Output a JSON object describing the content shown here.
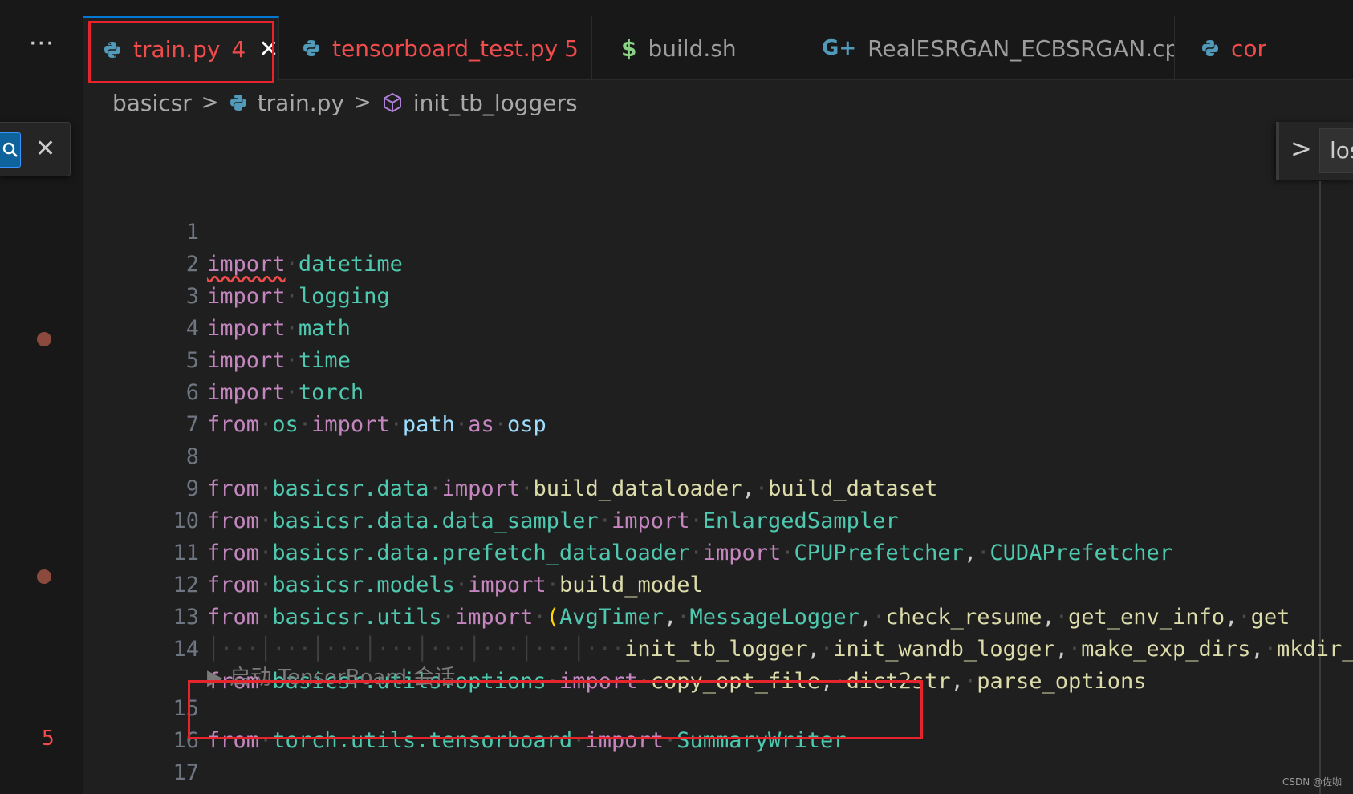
{
  "tabs": [
    {
      "label": "train.py",
      "count": "4",
      "close": "✕",
      "icon": "python-icon",
      "active": true
    },
    {
      "label": "tensorboard_test.py",
      "count": "5",
      "icon": "python-icon"
    },
    {
      "label": "build.sh",
      "icon": "shell-dollar-icon",
      "icon_text": "$"
    },
    {
      "label": "RealESRGAN_ECBSRGAN.cpp",
      "icon": "cpp-icon",
      "icon_text": "G+"
    },
    {
      "label": "cor",
      "icon": "python-icon"
    }
  ],
  "toolbar": {
    "more": "···"
  },
  "breadcrumb": {
    "items": [
      "basicsr",
      "train.py",
      "init_tb_loggers"
    ],
    "sep": ">"
  },
  "find_widget": {
    "close": "✕"
  },
  "sticky_widget": {
    "chevron": ">",
    "text": "los"
  },
  "lines": [
    {
      "num": "1"
    },
    {
      "num": "2"
    },
    {
      "num": "3"
    },
    {
      "num": "4"
    },
    {
      "num": "5"
    },
    {
      "num": "6"
    },
    {
      "num": "7"
    },
    {
      "num": "8"
    },
    {
      "num": "9"
    },
    {
      "num": "10"
    },
    {
      "num": "11"
    },
    {
      "num": "12"
    },
    {
      "num": "13"
    },
    {
      "num": "14"
    },
    {
      "num": "15"
    },
    {
      "num": "16"
    },
    {
      "num": "17"
    }
  ],
  "code": {
    "import": "import",
    "from": "from",
    "as": "as",
    "datetime": "datetime",
    "logging": "logging",
    "math": "math",
    "time": "time",
    "torch": "torch",
    "os": "os",
    "path": "path",
    "osp": "osp",
    "basicsr_data": "basicsr.data",
    "build_dataloader": "build_dataloader",
    "build_dataset": "build_dataset",
    "basicsr_data_sampler": "basicsr.data.data_sampler",
    "EnlargedSampler": "EnlargedSampler",
    "basicsr_prefetch": "basicsr.data.prefetch_dataloader",
    "CPUPrefetcher": "CPUPrefetcher",
    "CUDAPrefetcher": "CUDAPrefetcher",
    "basicsr_models": "basicsr.models",
    "build_model": "build_model",
    "basicsr_utils": "basicsr.utils",
    "open_paren": "(",
    "AvgTimer": "AvgTimer",
    "MessageLogger": "MessageLogger",
    "check_resume": "check_resume",
    "get_env_info": "get_env_info",
    "get_trunc": "get",
    "init_tb_logger": "init_tb_logger",
    "init_wandb_logger": "init_wandb_logger",
    "make_exp_dirs": "make_exp_dirs",
    "mkdir_trunc": "mkdir_",
    "basicsr_utils_options": "basicsr.utils.options",
    "copy_opt_file": "copy_opt_file",
    "dict2str": "dict2str",
    "parse_options": "parse_options",
    "torch_utils_tb": "torch.utils.tensorboard",
    "SummaryWriter": "SummaryWriter",
    "comma": ","
  },
  "codelens": "▶ 启动 TensorBoard 会话",
  "gutter_problem_count": "5",
  "watermark": "CSDN @佐咖",
  "colors": {
    "keyword": "#c586c0",
    "module": "#4ec9b0",
    "function": "#dcdcaa",
    "variable": "#9cdcfe",
    "error": "#f14c4c",
    "highlight_box": "#e5242b",
    "accent": "#0078d4"
  }
}
